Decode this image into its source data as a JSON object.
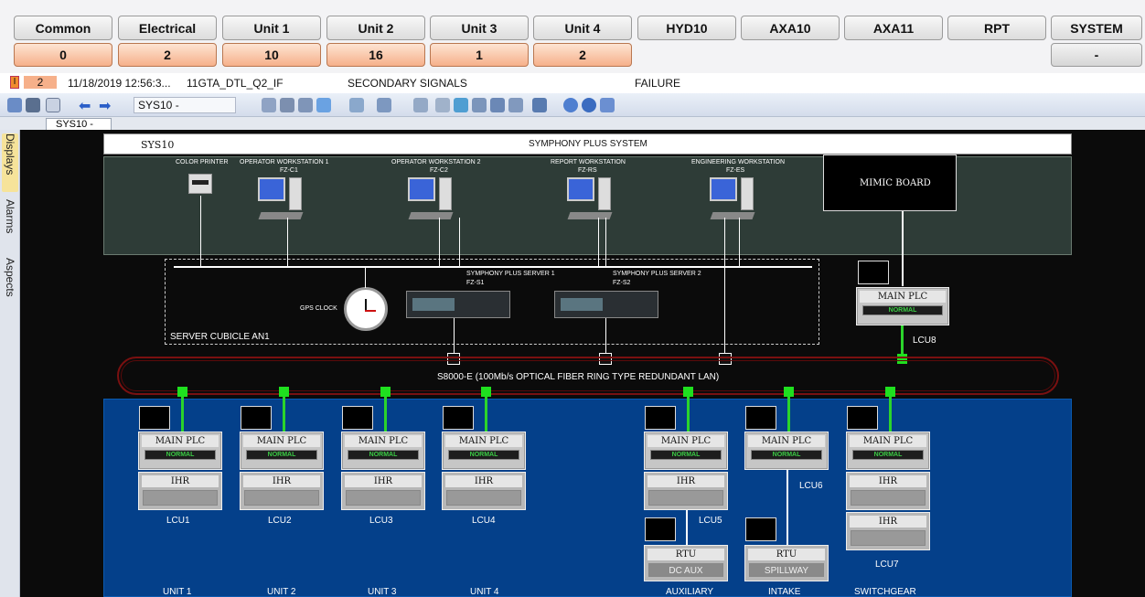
{
  "top_tabs": [
    "Common",
    "Electrical",
    "Unit 1",
    "Unit 2",
    "Unit 3",
    "Unit 4",
    "HYD10",
    "AXA10",
    "AXA11",
    "RPT",
    "SYSTEM"
  ],
  "counts": [
    "0",
    "2",
    "10",
    "16",
    "1",
    "2"
  ],
  "system_count": "-",
  "alarm": {
    "box1": "I",
    "box2": "2",
    "datetime": "11/18/2019 12:56:3...",
    "tag": "11GTA_DTL_Q2_IF",
    "description": "SECONDARY SIGNALS",
    "status": "FAILURE"
  },
  "toolbar": {
    "system_select": "SYS10 -"
  },
  "tab": {
    "label": "SYS10 -"
  },
  "side_tabs": [
    "Displays",
    "Alarms",
    "Aspects"
  ],
  "diagram": {
    "header_left": "SYS10",
    "header_title": "SYMPHONY PLUS SYSTEM",
    "color_printer": "COLOR PRINTER",
    "workstations": [
      {
        "name": "OPERATOR WORKSTATION 1",
        "tag": "FZ-C1"
      },
      {
        "name": "OPERATOR WORKSTATION 2",
        "tag": "FZ-C2"
      },
      {
        "name": "REPORT WORKSTATION",
        "tag": "FZ-RS"
      },
      {
        "name": "ENGINEERING WORKSTATION",
        "tag": "FZ-ES"
      }
    ],
    "mimic_board": "MIMIC BOARD",
    "server1": {
      "name": "SYMPHONY PLUS SERVER 1",
      "tag": "FZ-S1"
    },
    "server2": {
      "name": "SYMPHONY PLUS SERVER 2",
      "tag": "FZ-S2"
    },
    "gps_clock": "GPS CLOCK",
    "server_cubicle": "SERVER CUBICLE AN1",
    "lan_label": "S8000-E (100Mb/s OPTICAL FIBER RING TYPE REDUNDANT LAN)",
    "main_plc": "MAIN PLC",
    "normal": "NORMAL",
    "ihr": "IHR",
    "rtu": "RTU",
    "dc_aux": "DC AUX",
    "spillway": "SPILLWAY",
    "lcu_labels": [
      "LCU1",
      "LCU2",
      "LCU3",
      "LCU4",
      "LCU5",
      "LCU6",
      "LCU7",
      "LCU8"
    ],
    "unit_labels": [
      "UNIT 1",
      "UNIT 2",
      "UNIT 3",
      "UNIT 4",
      "AUXILIARY",
      "INTAKE",
      "SWITCHGEAR"
    ]
  },
  "colors": {
    "count_orange": "#f6b08a",
    "blue_panel": "#04408a",
    "dark_panel": "#2e3c37",
    "green_link": "#2bd42b",
    "ring_red": "#7a1010"
  }
}
